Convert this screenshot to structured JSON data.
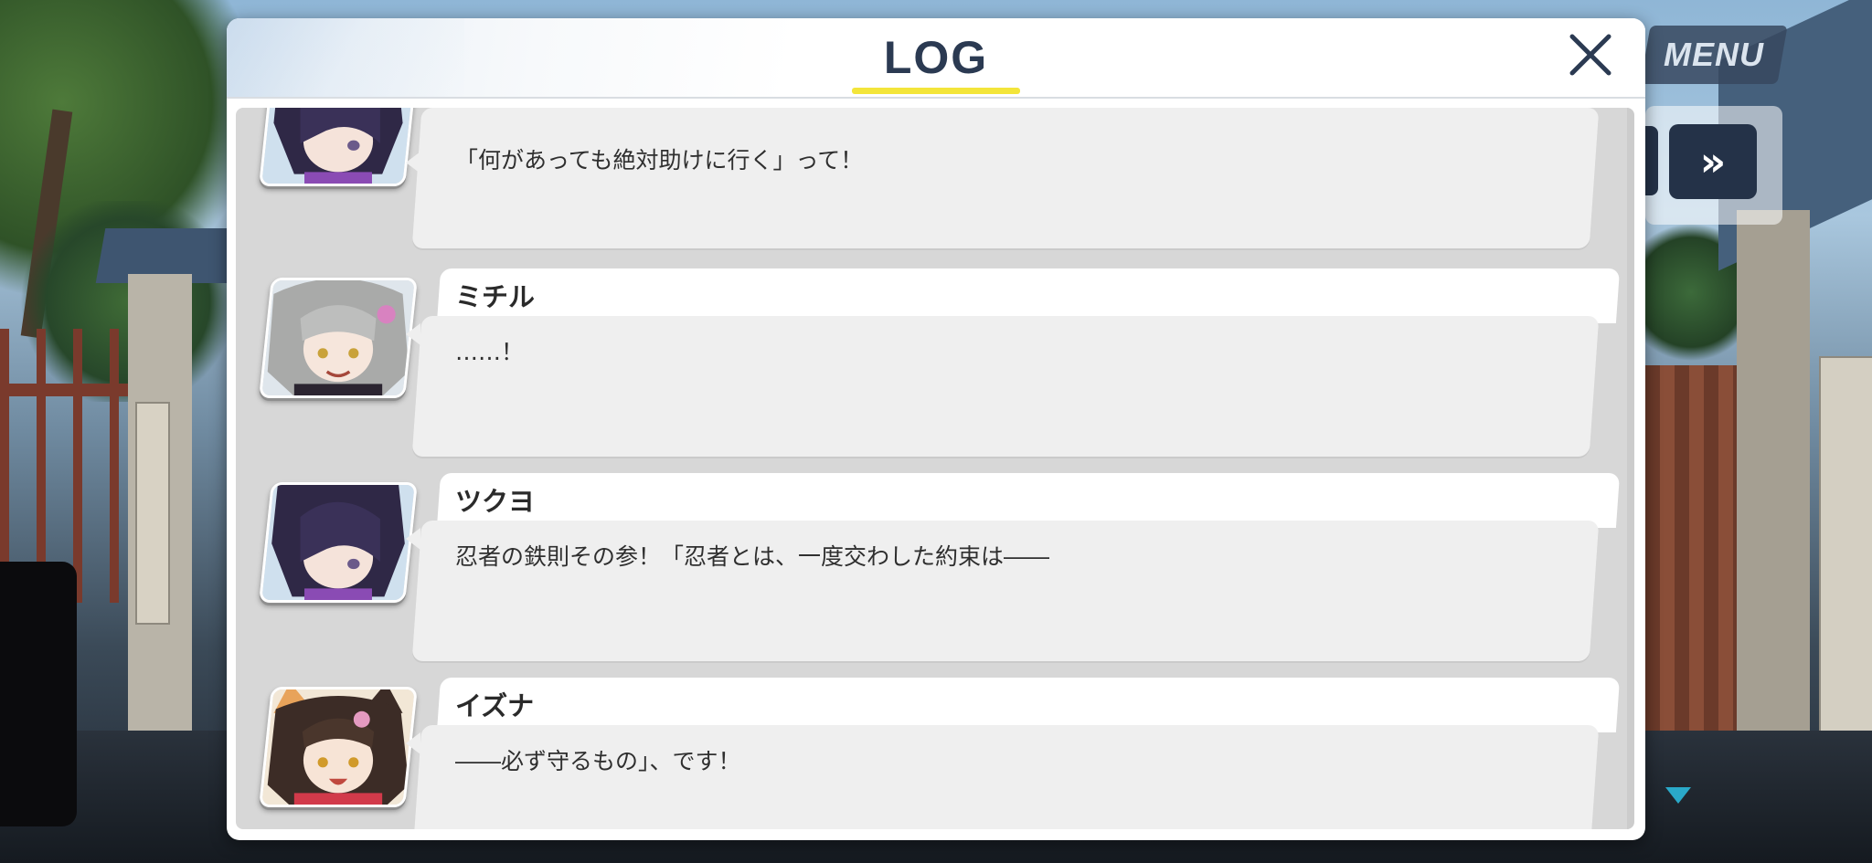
{
  "hud": {
    "menu_label": "MENU",
    "skip_glyph": "»"
  },
  "log": {
    "title": "LOG",
    "close_glyph": "✕",
    "entries": [
      {
        "speaker": "",
        "text": "「何があっても絶対助けに行く」って！",
        "portrait": "tsukuyo-portrait"
      },
      {
        "speaker": "ミチル",
        "text": "……！",
        "portrait": "michiru-portrait"
      },
      {
        "speaker": "ツクヨ",
        "text": "忍者の鉄則その参！「忍者とは、一度交わした約束は――",
        "portrait": "tsukuyo-portrait"
      },
      {
        "speaker": "イズナ",
        "text": "――必ず守るもの」、です！",
        "portrait": "izuna-portrait"
      }
    ]
  },
  "colors": {
    "title": "#2b3a52",
    "title_underline": "#f3e53a",
    "hud_dark": "#243248",
    "more_arrow": "#2aa9c9"
  }
}
